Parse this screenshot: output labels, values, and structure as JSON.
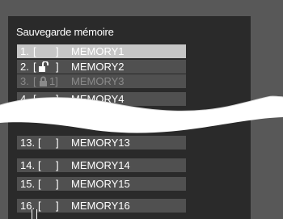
{
  "title": "Sauvegarde mémoire",
  "rows": [
    {
      "num": "1.",
      "open": "[",
      "close": "]",
      "label": "MEMORY1",
      "state": "selected"
    },
    {
      "num": "2.",
      "open": "[",
      "close": "]",
      "label": "MEMORY2",
      "state": "normal",
      "icon": "unlock-icon"
    },
    {
      "num": "3.",
      "open": "[",
      "close": "1]",
      "label": "MEMORY3",
      "state": "disabled",
      "icon": "lock-icon"
    },
    {
      "num": "4.",
      "open": "[",
      "close": "]",
      "label": "MEMORY4",
      "state": "normal"
    },
    {
      "num": "13.",
      "open": "[",
      "close": "]",
      "label": "MEMORY13",
      "state": "normal"
    },
    {
      "num": "14.",
      "open": "[",
      "close": "]",
      "label": "MEMORY14",
      "state": "normal"
    },
    {
      "num": "15.",
      "open": "[",
      "close": "]",
      "label": "MEMORY15",
      "state": "normal"
    },
    {
      "num": "16.",
      "open": "[",
      "close": "]",
      "label": "MEMORY16",
      "state": "normal"
    }
  ],
  "colors": {
    "page_bg": "#585858",
    "menu_bg": "#2a2a2a",
    "row_bg": "#505050",
    "selected_bg": "#c6c6c6",
    "disabled_text": "#8a8a8a"
  }
}
